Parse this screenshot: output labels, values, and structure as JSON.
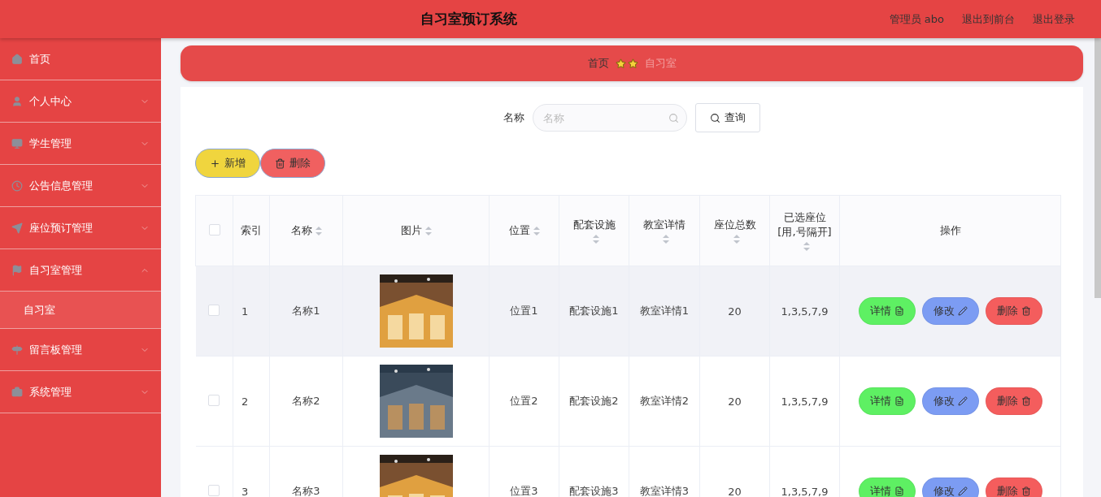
{
  "header": {
    "title": "自习室预订系统",
    "links": [
      "管理员 abo",
      "退出到前台",
      "退出登录"
    ]
  },
  "sidebar": {
    "items": [
      {
        "label": "首页",
        "expandable": false,
        "expanded": false
      },
      {
        "label": "个人中心",
        "expandable": true,
        "expanded": false
      },
      {
        "label": "学生管理",
        "expandable": true,
        "expanded": false
      },
      {
        "label": "公告信息管理",
        "expandable": true,
        "expanded": false
      },
      {
        "label": "座位预订管理",
        "expandable": true,
        "expanded": false
      },
      {
        "label": "自习室管理",
        "expandable": true,
        "expanded": true,
        "children": [
          {
            "label": "自习室",
            "selected": true
          }
        ]
      },
      {
        "label": "留言板管理",
        "expandable": true,
        "expanded": false
      },
      {
        "label": "系统管理",
        "expandable": true,
        "expanded": false
      }
    ]
  },
  "breadcrumb": {
    "items": [
      "首页",
      "自习室"
    ]
  },
  "search": {
    "label": "名称",
    "placeholder": "名称",
    "button": "查询"
  },
  "actions": [
    {
      "label": "新增",
      "kind": "add"
    },
    {
      "label": "删除",
      "kind": "delete"
    }
  ],
  "table": {
    "all_checked": false,
    "columns": [
      {
        "label": "索引",
        "sortable": false
      },
      {
        "label": "名称",
        "sortable": true
      },
      {
        "label": "图片",
        "sortable": true
      },
      {
        "label": "位置",
        "sortable": true
      },
      {
        "label": "配套设施",
        "sortable": true
      },
      {
        "label": "教室详情",
        "sortable": true
      },
      {
        "label": "座位总数",
        "sortable": true
      },
      {
        "label": "已选座位[用,号隔开]",
        "sortable": true
      },
      {
        "label": "操作",
        "sortable": false
      }
    ],
    "rows": [
      {
        "checked": false,
        "highlighted": true,
        "cells": [
          "1",
          "名称1",
          {
            "kind": "picture"
          },
          "位置1",
          "配套设施1",
          "教室详情1",
          "20",
          "1,3,5,7,9"
        ],
        "buttons": [
          {
            "label": "详情",
            "kind": "detail"
          },
          {
            "label": "修改",
            "kind": "edit"
          },
          {
            "label": "删除",
            "kind": "delete"
          }
        ]
      },
      {
        "checked": false,
        "highlighted": false,
        "cells": [
          "2",
          "名称2",
          {
            "kind": "picture"
          },
          "位置2",
          "配套设施2",
          "教室详情2",
          "20",
          "1,3,5,7,9"
        ],
        "buttons": [
          {
            "label": "详情",
            "kind": "detail"
          },
          {
            "label": "修改",
            "kind": "edit"
          },
          {
            "label": "删除",
            "kind": "delete"
          }
        ]
      },
      {
        "checked": false,
        "highlighted": false,
        "cells": [
          "3",
          "名称3",
          {
            "kind": "picture"
          },
          "位置3",
          "配套设施3",
          "教室详情3",
          "20",
          "1,3,5,7,9"
        ],
        "buttons": [
          {
            "label": "详情",
            "kind": "detail"
          },
          {
            "label": "修改",
            "kind": "edit"
          },
          {
            "label": "删除",
            "kind": "delete"
          }
        ]
      }
    ]
  }
}
